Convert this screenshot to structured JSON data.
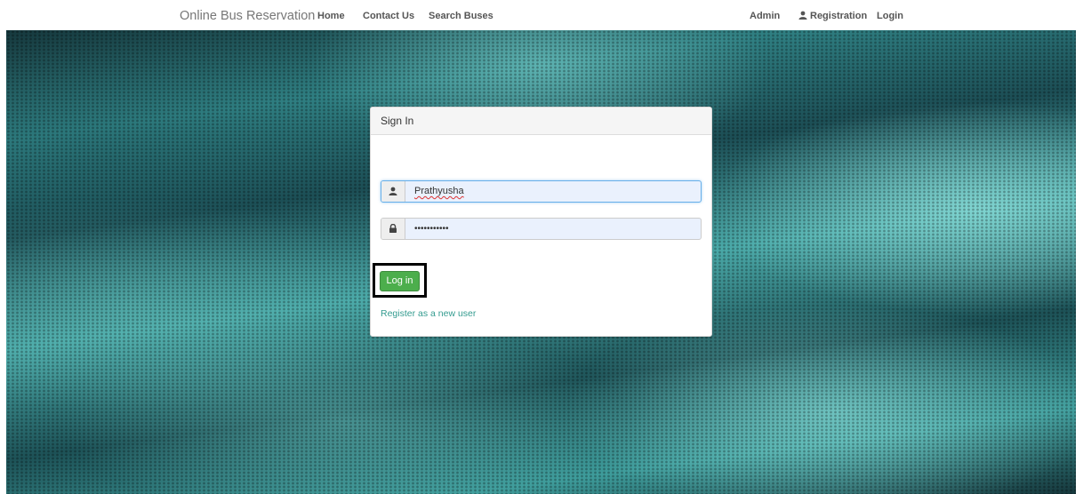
{
  "navbar": {
    "brand": "Online Bus Reservation",
    "items": [
      {
        "label": "Home"
      },
      {
        "label": "Contact Us"
      },
      {
        "label": "Search Buses"
      }
    ],
    "right_items": [
      {
        "label": "Admin"
      },
      {
        "label": "Registration",
        "icon": "user-icon"
      },
      {
        "label": "Login"
      }
    ]
  },
  "signin": {
    "title": "Sign In",
    "username": {
      "value": "Prathyusha",
      "icon": "user-icon"
    },
    "password": {
      "value": "•••••••••••",
      "icon": "lock-icon"
    },
    "login_button": "Log in",
    "register_link": "Register as a new user"
  },
  "colors": {
    "login_button": "#4cae4c",
    "link": "#339b8f",
    "background": "#2f7f82"
  }
}
